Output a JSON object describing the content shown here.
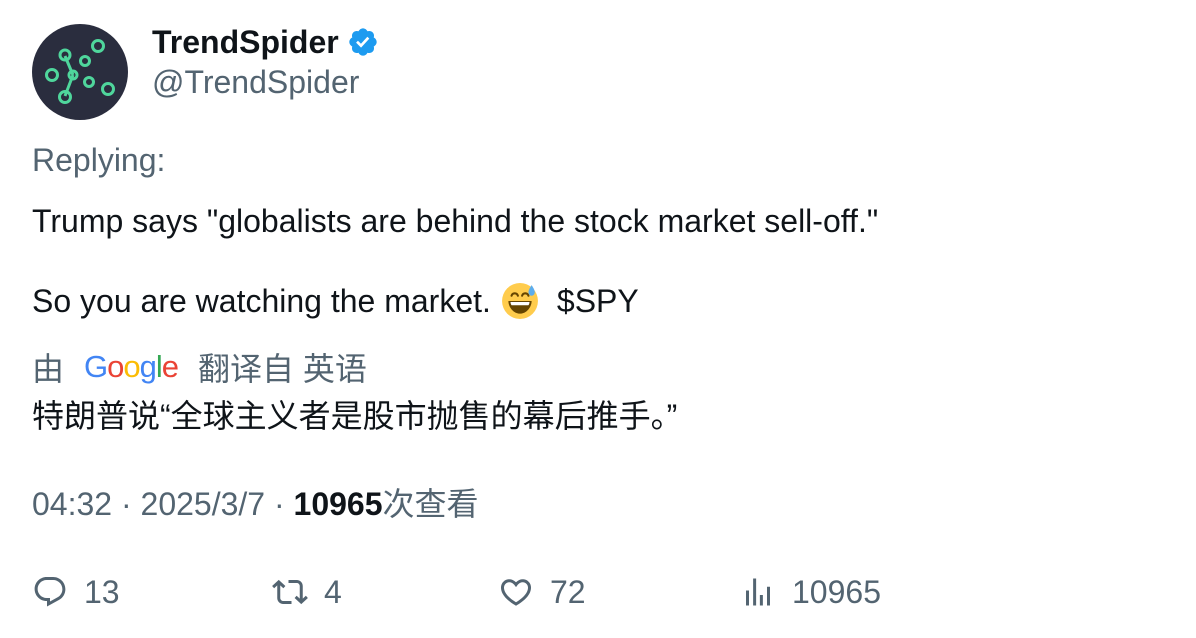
{
  "author": {
    "display_name": "TrendSpider",
    "handle": "@TrendSpider",
    "verified": true,
    "avatar_icon": "trendspider-logo-icon"
  },
  "replying_label": "Replying:",
  "body": {
    "line1": "Trump says \"globalists are behind the stock market sell-off.\"",
    "line2_text": "So you are watching the market.",
    "line2_emoji": "grinning-face-with-sweat-emoji",
    "line2_ticker": "$SPY"
  },
  "translation": {
    "prefix": "由",
    "provider": "Google",
    "suffix": "翻译自 英语",
    "text": "特朗普说“全球主义者是股市抛售的幕后推手。”"
  },
  "meta": {
    "time": "04:32",
    "separator": " · ",
    "date": "2025/3/7",
    "views_count": "10965",
    "views_label": "次查看"
  },
  "actions": {
    "replies": "13",
    "retweets": "4",
    "likes": "72",
    "views": "10965"
  },
  "colors": {
    "primary_text": "#0f1419",
    "secondary_text": "#536471",
    "verified_blue": "#1d9bf0",
    "avatar_bg": "#2a2d3e",
    "avatar_accent": "#4fd69c"
  }
}
